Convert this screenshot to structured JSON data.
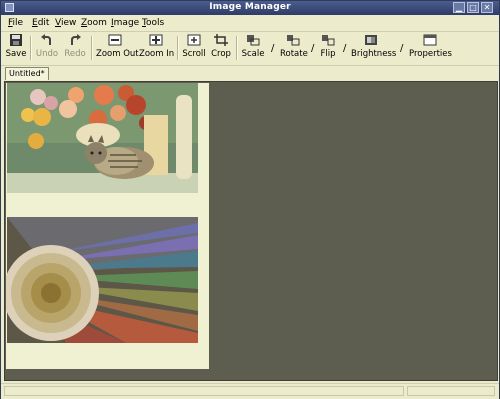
{
  "window": {
    "title": "Image Manager"
  },
  "menu": {
    "items": [
      {
        "first": "F",
        "rest": "ile"
      },
      {
        "first": "E",
        "rest": "dit"
      },
      {
        "first": "V",
        "rest": "iew"
      },
      {
        "first": "Z",
        "rest": "oom"
      },
      {
        "first": "I",
        "rest": "mage"
      },
      {
        "first": "T",
        "rest": "ools"
      }
    ]
  },
  "toolbar": {
    "save": "Save",
    "undo": "Undo",
    "redo": "Redo",
    "zoom_out": "Zoom Out",
    "zoom_in": "Zoom In",
    "scroll": "Scroll",
    "crop": "Crop",
    "scale": "Scale",
    "rotate": "Rotate",
    "flip": "Flip",
    "brightness": "Brightness",
    "properties": "Properties",
    "slash": "/"
  },
  "tabs": [
    {
      "label": "Untitled*"
    }
  ],
  "colors": {
    "canvas_bg": "#5d5d50",
    "chrome_bg": "#ececcc",
    "titlebar": "#2e3c66"
  }
}
